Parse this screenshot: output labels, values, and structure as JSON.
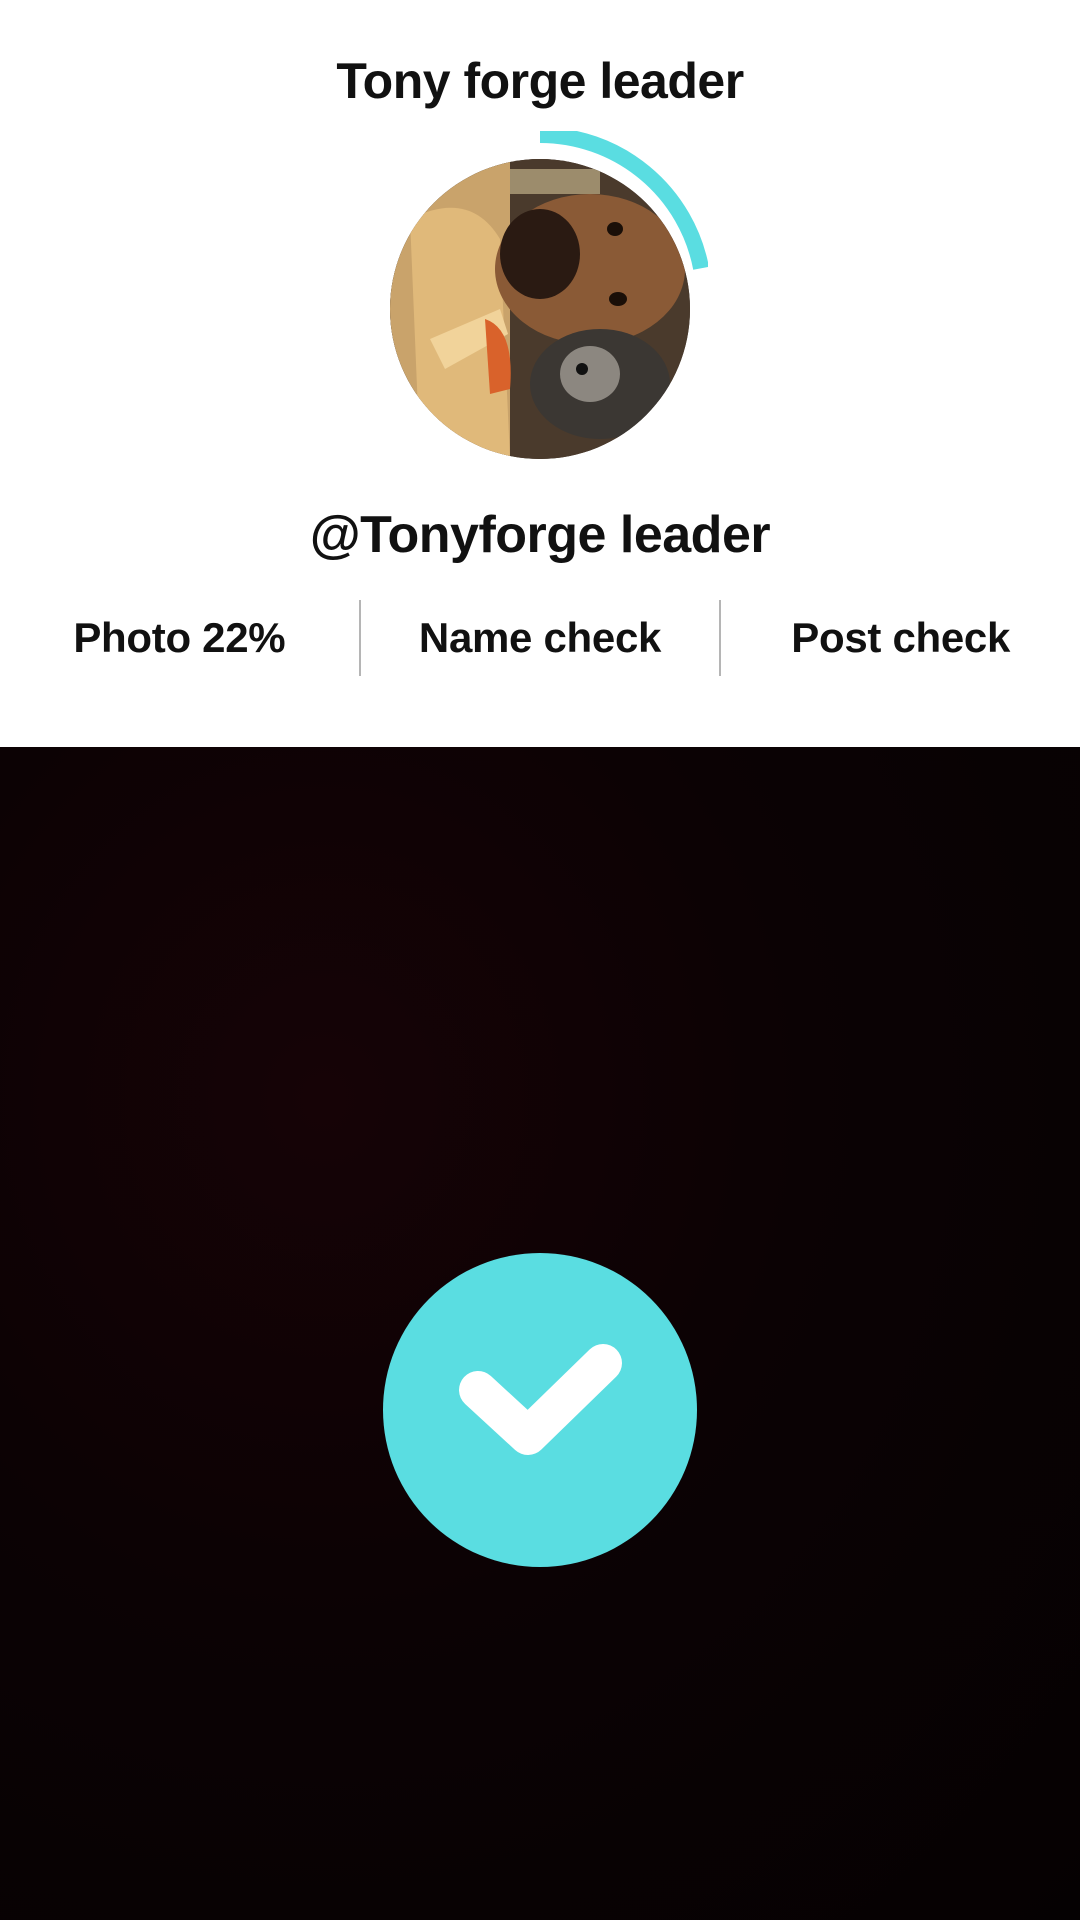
{
  "profile": {
    "display_name": "Tony forge leader",
    "handle": "@Tonyforge leader",
    "photo_progress": 0.22
  },
  "checks": {
    "photo": "Photo 22%",
    "name": "Name check",
    "post": "Post check"
  },
  "colors": {
    "accent": "#5adde1",
    "text": "#111111",
    "divider": "#b5b5b5",
    "background_dark": "#0b0204"
  },
  "icons": {
    "confirm": "check-icon"
  }
}
